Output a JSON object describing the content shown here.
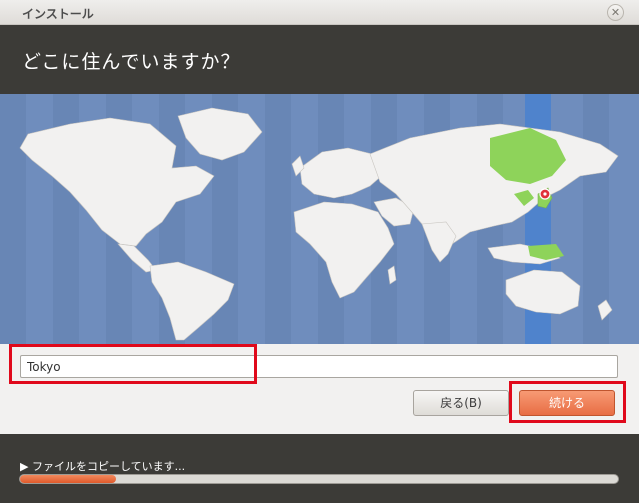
{
  "window": {
    "title": "インストール",
    "close_glyph": "✕"
  },
  "header": {
    "heading": "どこに住んでいますか？"
  },
  "map": {
    "ocean_color": "#6f8dbd",
    "land_color": "#f2f1f0",
    "highlight_color": "#8ed35a",
    "band_color": "#4f83cc",
    "pin_color": "#e0303a"
  },
  "location": {
    "value": "Tokyo"
  },
  "buttons": {
    "back_label": "戻る(B)",
    "continue_label": "続ける"
  },
  "status": {
    "text": "▶ ファイルをコピーしています...",
    "progress_fraction": 0.16
  },
  "accent_color": "#e86d44",
  "annotation_color": "#e0091b"
}
